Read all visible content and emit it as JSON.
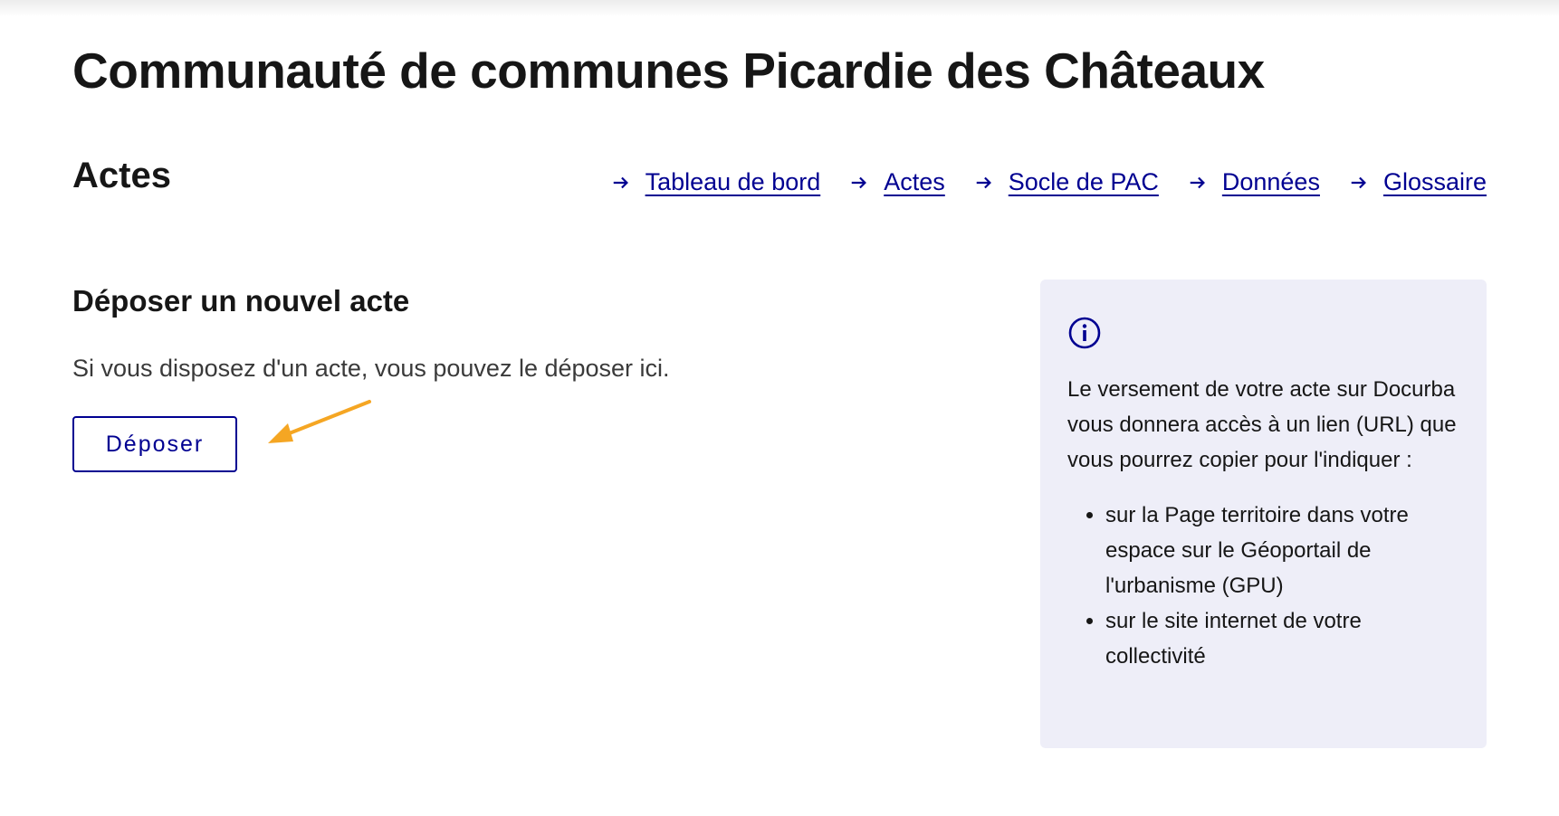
{
  "header": {
    "title": "Communauté de communes Picardie des Châteaux"
  },
  "section": {
    "title": "Actes"
  },
  "nav": {
    "items": [
      {
        "label": "Tableau de bord",
        "icon": "arrow-right-icon"
      },
      {
        "label": "Actes",
        "icon": "arrow-right-icon"
      },
      {
        "label": "Socle de PAC",
        "icon": "arrow-right-icon"
      },
      {
        "label": "Données",
        "icon": "arrow-right-icon"
      },
      {
        "label": "Glossaire",
        "icon": "arrow-right-icon"
      }
    ]
  },
  "deposit": {
    "heading": "Déposer un nouvel acte",
    "description": "Si vous disposez d'un acte, vous pouvez le déposer ici.",
    "button_label": "Déposer"
  },
  "info": {
    "icon": "info-circle-icon",
    "text": "Le versement de votre acte sur Docurba vous donnera accès à un lien (URL) que vous pourrez copier pour l'indiquer :",
    "bullets": [
      "sur la Page territoire dans votre espace sur le Géoportail de l'urbanisme (GPU)",
      "sur le site internet de votre collectivité"
    ]
  },
  "colors": {
    "primary": "#000091",
    "annotation_arrow": "#f5a623",
    "info_background": "#eeeef8",
    "text": "#161616"
  }
}
